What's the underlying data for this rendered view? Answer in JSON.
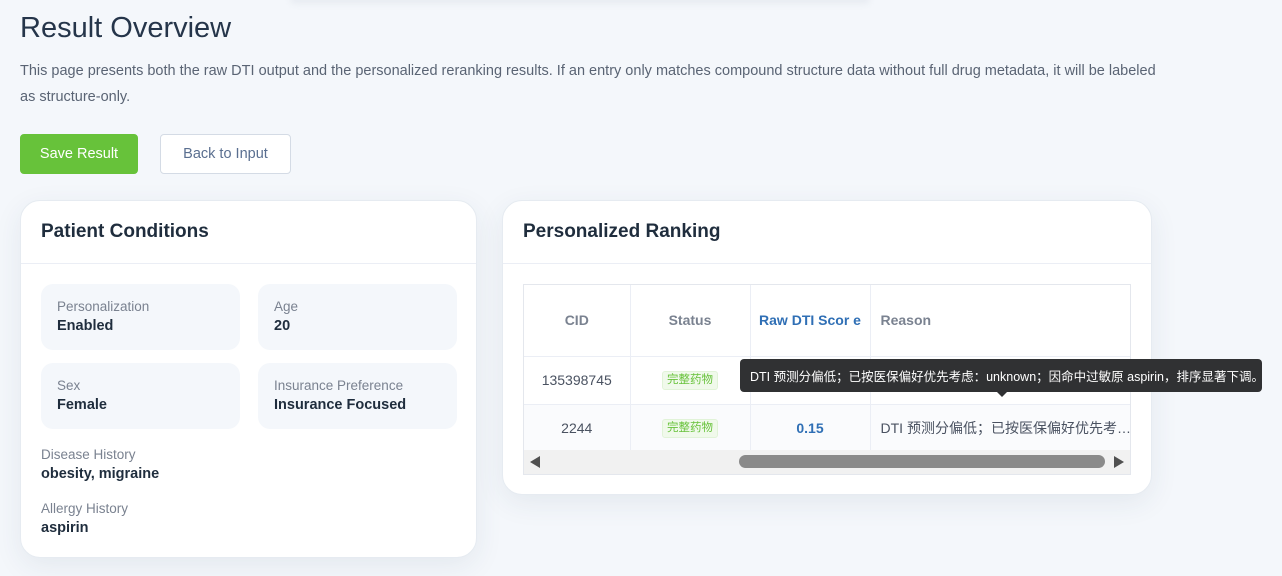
{
  "header": {
    "title": "Result Overview",
    "description": "This page presents both the raw DTI output and the personalized reranking results. If an entry only matches compound structure data without full drug metadata, it will be labeled as structure-only."
  },
  "actions": {
    "save_label": "Save Result",
    "back_label": "Back to Input"
  },
  "patient": {
    "title": "Patient Conditions",
    "personalization": {
      "label": "Personalization",
      "value": "Enabled"
    },
    "age": {
      "label": "Age",
      "value": "20"
    },
    "sex": {
      "label": "Sex",
      "value": "Female"
    },
    "insurance": {
      "label": "Insurance Preference",
      "value": "Insurance Focused"
    },
    "disease": {
      "label": "Disease History",
      "value": "obesity, migraine"
    },
    "allergy": {
      "label": "Allergy History",
      "value": "aspirin"
    }
  },
  "ranking": {
    "title": "Personalized Ranking",
    "columns": [
      "CID",
      "Status",
      "Raw DTI Scor e",
      "Reason"
    ],
    "rows": [
      {
        "cid": "135398745",
        "status": "完整药物",
        "score": "",
        "reason": ""
      },
      {
        "cid": "2244",
        "status": "完整药物",
        "score": "0.15",
        "reason": "DTI 预测分偏低；已按医保偏好优先考虑：unknown；因命中过敏原 aspirin，排序显著下调。"
      }
    ]
  },
  "tooltip": {
    "text": "DTI 预测分偏低；已按医保偏好优先考虑：unknown；因命中过敏原 aspirin，排序显著下调。"
  },
  "colors": {
    "primary_green": "#67c23a",
    "link_blue": "#2f6fb5",
    "tooltip_bg": "#303133"
  }
}
